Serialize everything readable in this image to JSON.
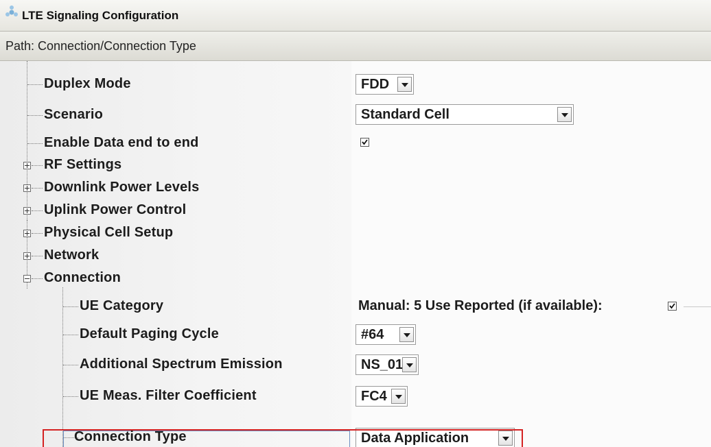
{
  "window": {
    "title": "LTE Signaling Configuration",
    "icon": "lte-config-icon"
  },
  "path": {
    "text": "Path:  Connection/Connection Type"
  },
  "tree": {
    "duplex_mode": {
      "label": "Duplex Mode",
      "value": "FDD"
    },
    "scenario": {
      "label": "Scenario",
      "value": "Standard Cell"
    },
    "enable_data": {
      "label": "Enable Data end to end",
      "checked": true
    },
    "rf_settings": {
      "label": "RF Settings"
    },
    "downlink_power": {
      "label": "Downlink Power Levels"
    },
    "uplink_power": {
      "label": "Uplink Power Control"
    },
    "physical_cell": {
      "label": "Physical Cell Setup"
    },
    "network": {
      "label": "Network"
    },
    "connection": {
      "label": "Connection",
      "ue_category": {
        "label": "UE Category",
        "value": "Manual:  5   Use Reported (if available):",
        "use_reported": true
      },
      "paging_cycle": {
        "label": "Default Paging Cycle",
        "value": "#64"
      },
      "spectrum_emission": {
        "label": "Additional Spectrum Emission",
        "value": "NS_01"
      },
      "meas_filter": {
        "label": "UE Meas. Filter Coefficient",
        "value": "FC4"
      },
      "connection_type": {
        "label": "Connection Type",
        "value": "Data Application"
      }
    }
  },
  "colors": {
    "highlight": "#d42222",
    "selection_border": "#6d8fc2"
  }
}
